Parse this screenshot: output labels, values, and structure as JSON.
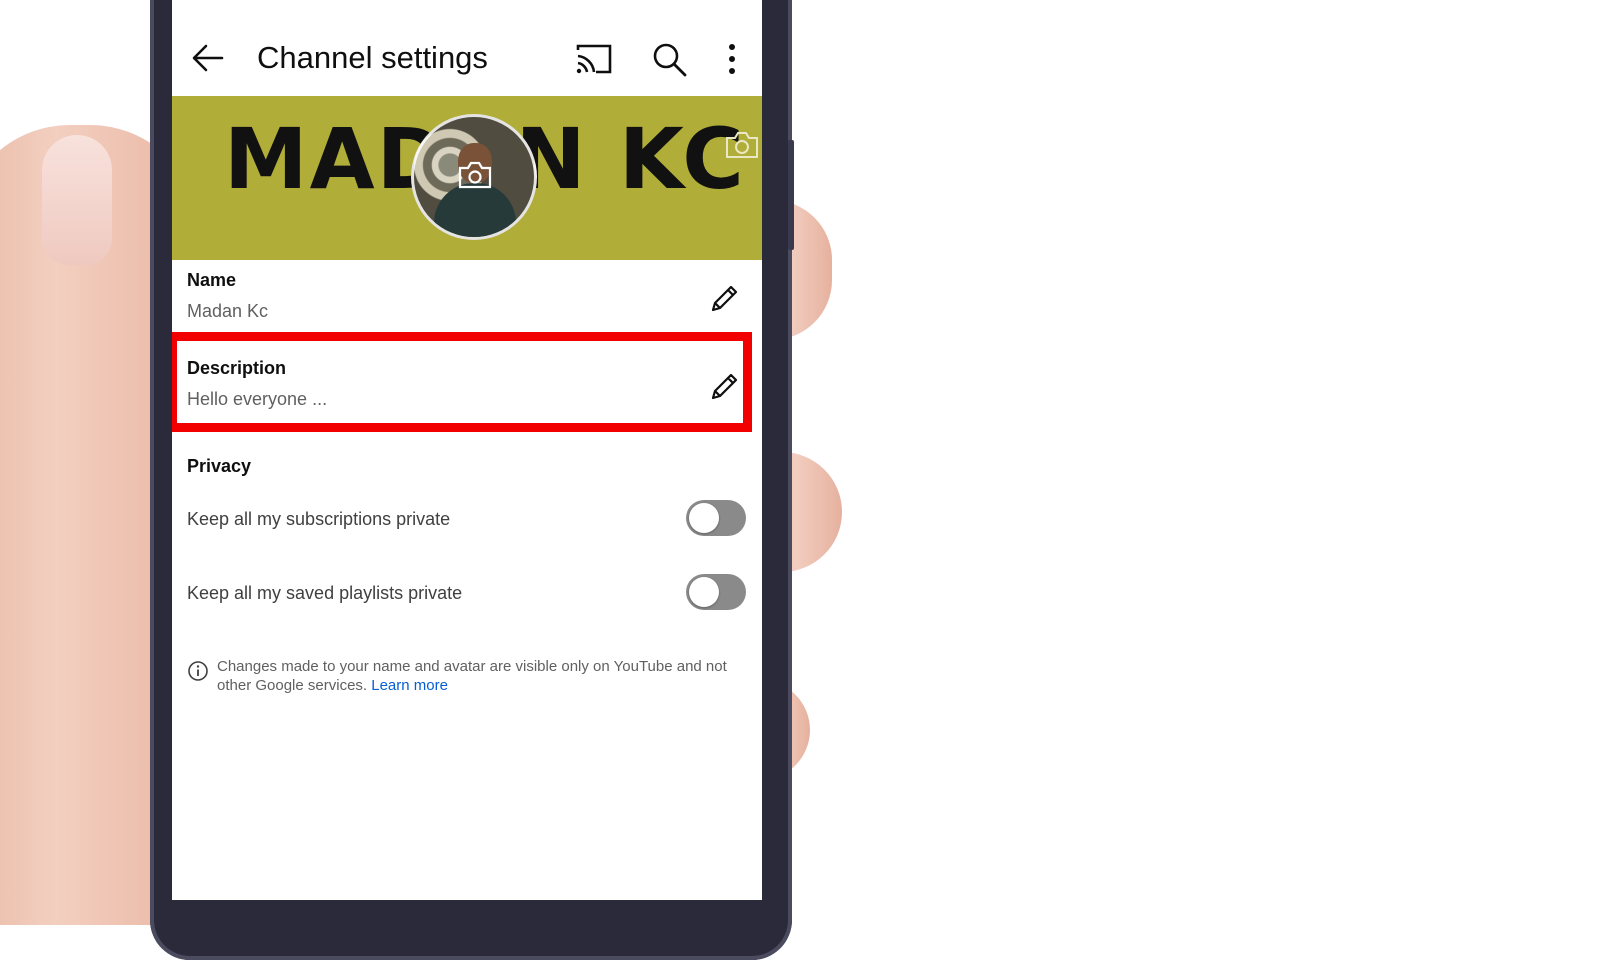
{
  "appbar": {
    "title": "Channel settings",
    "icons": [
      "back-arrow-icon",
      "cast-icon",
      "search-icon",
      "more-vert-icon"
    ]
  },
  "banner": {
    "text": "MADAN KC",
    "color": "#b0ad39"
  },
  "name": {
    "label": "Name",
    "value": "Madan Kc"
  },
  "description": {
    "label": "Description",
    "value": "Hello everyone ...",
    "highlight_color": "#f20000"
  },
  "privacy": {
    "heading": "Privacy",
    "toggles": [
      {
        "label": "Keep all my subscriptions private",
        "on": false
      },
      {
        "label": "Keep all my saved playlists private",
        "on": false
      }
    ]
  },
  "info": {
    "text": "Changes made to your name and avatar are visible only on YouTube and not other Google services.",
    "link": "Learn more"
  }
}
